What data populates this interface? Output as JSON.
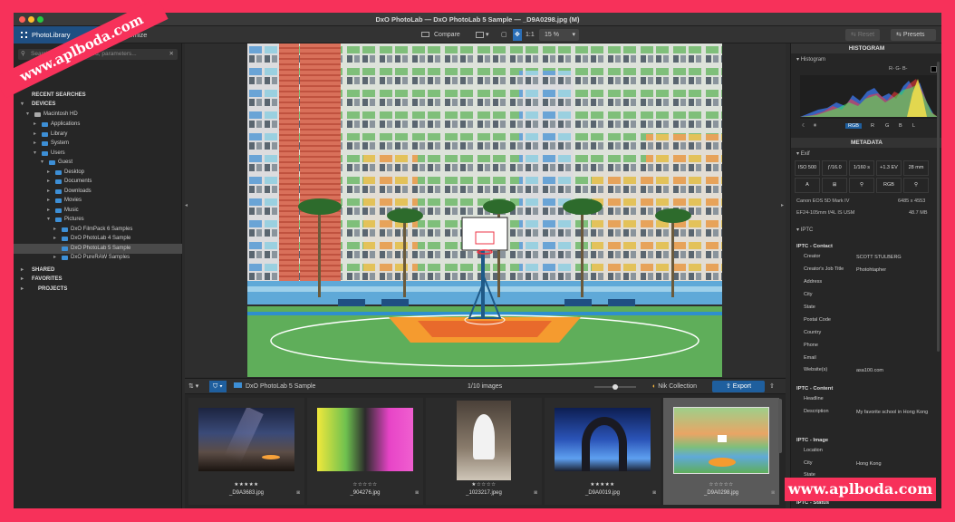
{
  "window": {
    "title": "DxO PhotoLab — DxO PhotoLab 5 Sample — _D9A0298.jpg (M)"
  },
  "toolbar": {
    "tab_photolibrary": "PhotoLibrary",
    "tab_customize": "Customize",
    "compare": "Compare",
    "zoom_11": "1:1",
    "zoom_value": "15 %",
    "reset": "Reset",
    "presets": "Presets"
  },
  "left": {
    "search_placeholder": "Search by folder, keyword, parameters...",
    "recent_searches": "RECENT SEARCHES",
    "devices": "DEVICES",
    "tree": [
      {
        "label": "Macintosh HD"
      },
      {
        "label": "Applications"
      },
      {
        "label": "Library"
      },
      {
        "label": "System"
      },
      {
        "label": "Users"
      },
      {
        "label": "Guest"
      },
      {
        "label": "Desktop"
      },
      {
        "label": "Documents"
      },
      {
        "label": "Downloads"
      },
      {
        "label": "Movies"
      },
      {
        "label": "Music"
      },
      {
        "label": "Pictures"
      },
      {
        "label": "DxO FilmPack 6 Samples"
      },
      {
        "label": "DxO PhotoLab 4 Sample"
      },
      {
        "label": "DxO PhotoLab 5 Sample"
      },
      {
        "label": "DxO PureRAW Samples"
      }
    ],
    "shared": "SHARED",
    "favorites": "FAVORITES",
    "projects": "PROJECTS"
  },
  "filmstrip": {
    "folder": "DxO PhotoLab 5 Sample",
    "count": "1/10 images",
    "nik": "Nik Collection",
    "export": "Export",
    "thumbs": [
      {
        "stars": "★★★★★",
        "name": "_D9A3683.jpg"
      },
      {
        "stars": "☆☆☆☆☆",
        "name": "_904276.jpg"
      },
      {
        "stars": "★☆☆☆☆",
        "name": "_1023217.jpeg"
      },
      {
        "stars": "★★★★★",
        "name": "_D9A0019.jpg"
      },
      {
        "stars": "☆☆☆☆☆",
        "name": "_D9A0298.jpg"
      }
    ]
  },
  "right": {
    "histogram_title": "HISTOGRAM",
    "histogram_sub": "Histogram",
    "rgb_readout": "R- G- B-",
    "channels": [
      "RGB",
      "R",
      "G",
      "B",
      "L"
    ],
    "metadata_title": "METADATA",
    "exif": "Exif",
    "exif_values": [
      "ISO 500",
      "ƒ/16.0",
      "1/160 s",
      "+1.3 EV",
      "28 mm"
    ],
    "exif_icons": [
      "A",
      "⊞",
      "⚲",
      "RGB",
      "⚲"
    ],
    "camera": "Canon EOS 5D Mark IV",
    "resolution": "6485 x 4553",
    "lens": "EF24-105mm f/4L IS USM",
    "size": "48.7 MB",
    "iptc": "IPTC",
    "iptc_contact": "IPTC - Contact",
    "contact_rows": [
      {
        "k": "Creator",
        "v": "SCOTT STULBERG"
      },
      {
        "k": "Creator's Job Title",
        "v": "Photohtapher"
      },
      {
        "k": "Address",
        "v": ""
      },
      {
        "k": "City",
        "v": ""
      },
      {
        "k": "State",
        "v": ""
      },
      {
        "k": "Postal Code",
        "v": ""
      },
      {
        "k": "Country",
        "v": ""
      },
      {
        "k": "Phone",
        "v": ""
      },
      {
        "k": "Email",
        "v": ""
      },
      {
        "k": "Website(s)",
        "v": "asa100.com"
      }
    ],
    "iptc_content": "IPTC - Content",
    "content_rows": [
      {
        "k": "Headline",
        "v": ""
      },
      {
        "k": "Description",
        "v": "My favorite school in Hong Kong"
      }
    ],
    "iptc_image": "IPTC - Image",
    "image_rows": [
      {
        "k": "Location",
        "v": ""
      },
      {
        "k": "City",
        "v": "Hong Kong"
      },
      {
        "k": "State",
        "v": ""
      }
    ],
    "iptc_status": "IPTC - Status"
  },
  "watermark": "www.aplboda.com",
  "colors": {
    "accent": "#1f4f82",
    "export": "#1f5f9e",
    "frame": "#f7315a"
  }
}
